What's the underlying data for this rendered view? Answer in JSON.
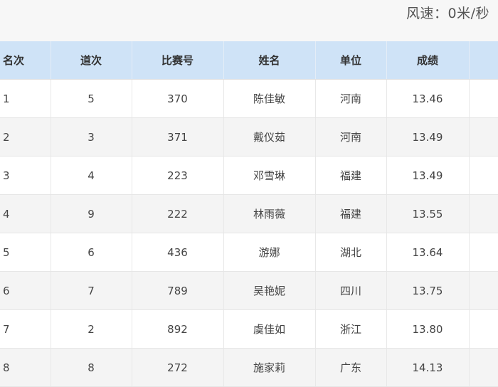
{
  "wind_speed": "风速：0米/秒",
  "table": {
    "headers": [
      "名次",
      "道次",
      "比赛号",
      "姓名",
      "单位",
      "成绩",
      ""
    ],
    "rows": [
      [
        "1",
        "5",
        "370",
        "陈佳敏",
        "河南",
        "13.46",
        ""
      ],
      [
        "2",
        "3",
        "371",
        "戴仪茹",
        "河南",
        "13.49",
        ""
      ],
      [
        "3",
        "4",
        "223",
        "邓雪琳",
        "福建",
        "13.49",
        ""
      ],
      [
        "4",
        "9",
        "222",
        "林雨薇",
        "福建",
        "13.55",
        ""
      ],
      [
        "5",
        "6",
        "436",
        "游娜",
        "湖北",
        "13.64",
        ""
      ],
      [
        "6",
        "7",
        "789",
        "吴艳妮",
        "四川",
        "13.75",
        ""
      ],
      [
        "7",
        "2",
        "892",
        "虞佳如",
        "浙江",
        "13.80",
        ""
      ],
      [
        "8",
        "8",
        "272",
        "施家莉",
        "广东",
        "14.13",
        ""
      ]
    ]
  }
}
